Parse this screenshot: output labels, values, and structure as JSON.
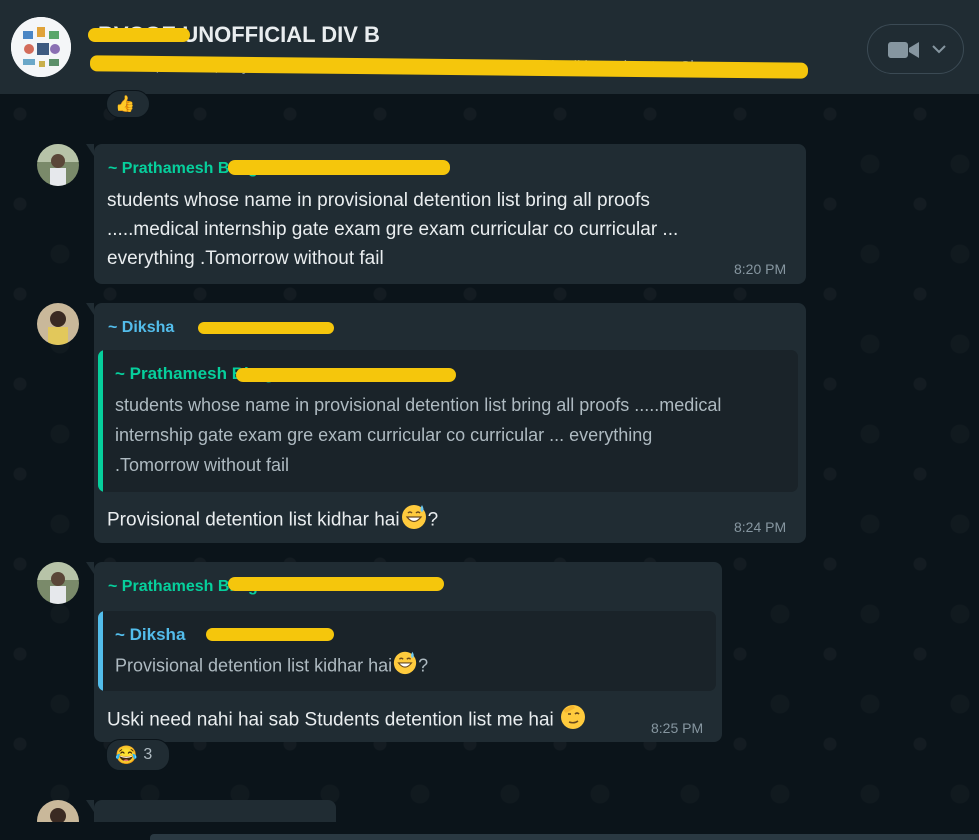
{
  "header": {
    "title": "BVCOE UNOFFICIAL DIV B",
    "members": "Bhushan, Devesh, Dhyanesh, Gauri, Hrishi, Mayuresh, Mansi, Nikunj, Nikita, Princeton, Shr..."
  },
  "reactions": {
    "top_emoji": "👍",
    "bottom_emoji": "😂",
    "bottom_count": "3"
  },
  "messages": [
    {
      "sender": "~ Prathamesh Bhagat",
      "text_lines": [
        "students whose name in provisional detention list bring all proofs",
        ".....medical internship gate exam gre exam curricular co curricular ...",
        "everything .Tomorrow without fail"
      ],
      "time": "8:20 PM"
    },
    {
      "sender": "~ Diksha",
      "quoted_sender": "~ Prathamesh Bhagat",
      "quoted_lines": [
        "students whose name in provisional detention list bring all proofs .....medical",
        "internship gate exam gre exam curricular co curricular ... everything",
        ".Tomorrow without fail"
      ],
      "text": "Provisional detention list kidhar hai",
      "text_suffix": "?",
      "time": "8:24 PM"
    },
    {
      "sender": "~ Prathamesh Bhagat",
      "quoted_sender": "~ Diksha",
      "quoted_text": "Provisional detention list kidhar hai",
      "quoted_suffix": "?",
      "text": "Uski need nahi hai sab Students detention list me hai",
      "time": "8:25 PM"
    }
  ],
  "colors": {
    "background": "#0b141a",
    "bubble": "#202c33",
    "sender_green": "#06cf9c",
    "sender_blue": "#53bdeb",
    "redaction": "#f5c60c"
  },
  "icons": [
    "group-avatar",
    "video-camera-icon",
    "chevron-down-icon",
    "thumbs-up-emoji",
    "sweat-smile-emoji",
    "salute-emoji",
    "tears-of-joy-emoji"
  ]
}
